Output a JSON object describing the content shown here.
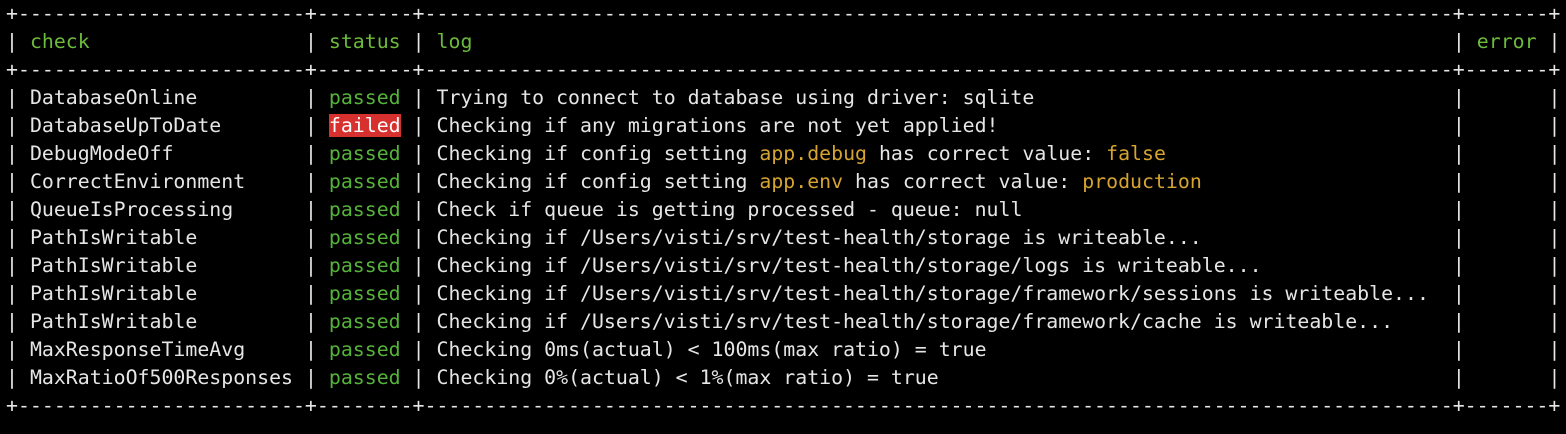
{
  "colors": {
    "background": "#000000",
    "text": "#e6e6e6",
    "header": "#6cbb3c",
    "passed": "#56b33a",
    "failed_bg": "#d7312f",
    "highlight": "#d6a431"
  },
  "columns": {
    "check": "check",
    "status": "status",
    "log": "log",
    "error": "error"
  },
  "rows": [
    {
      "check": "DatabaseOnline",
      "status": "passed",
      "log": [
        {
          "t": "Trying to connect to database using driver: sqlite",
          "c": "txt"
        }
      ],
      "error": ""
    },
    {
      "check": "DatabaseUpToDate",
      "status": "failed",
      "log": [
        {
          "t": "Checking if any migrations are not yet applied!",
          "c": "txt"
        }
      ],
      "error": ""
    },
    {
      "check": "DebugModeOff",
      "status": "passed",
      "log": [
        {
          "t": "Checking if config setting ",
          "c": "txt"
        },
        {
          "t": "app.debug",
          "c": "hl"
        },
        {
          "t": " has correct value: ",
          "c": "txt"
        },
        {
          "t": "false",
          "c": "hl"
        }
      ],
      "error": ""
    },
    {
      "check": "CorrectEnvironment",
      "status": "passed",
      "log": [
        {
          "t": "Checking if config setting ",
          "c": "txt"
        },
        {
          "t": "app.env",
          "c": "hl"
        },
        {
          "t": " has correct value: ",
          "c": "txt"
        },
        {
          "t": "production",
          "c": "hl"
        }
      ],
      "error": ""
    },
    {
      "check": "QueueIsProcessing",
      "status": "passed",
      "log": [
        {
          "t": "Check if queue is getting processed - queue: null",
          "c": "txt"
        }
      ],
      "error": ""
    },
    {
      "check": "PathIsWritable",
      "status": "passed",
      "log": [
        {
          "t": "Checking if /Users/visti/srv/test-health/storage is writeable...",
          "c": "txt"
        }
      ],
      "error": ""
    },
    {
      "check": "PathIsWritable",
      "status": "passed",
      "log": [
        {
          "t": "Checking if /Users/visti/srv/test-health/storage/logs is writeable...",
          "c": "txt"
        }
      ],
      "error": ""
    },
    {
      "check": "PathIsWritable",
      "status": "passed",
      "log": [
        {
          "t": "Checking if /Users/visti/srv/test-health/storage/framework/sessions is writeable...",
          "c": "txt"
        }
      ],
      "error": ""
    },
    {
      "check": "PathIsWritable",
      "status": "passed",
      "log": [
        {
          "t": "Checking if /Users/visti/srv/test-health/storage/framework/cache is writeable...",
          "c": "txt"
        }
      ],
      "error": ""
    },
    {
      "check": "MaxResponseTimeAvg",
      "status": "passed",
      "log": [
        {
          "t": "Checking 0ms(actual) < 100ms(max ratio) = true",
          "c": "txt"
        }
      ],
      "error": ""
    },
    {
      "check": "MaxRatioOf500Responses",
      "status": "passed",
      "log": [
        {
          "t": "Checking 0%(actual) < 1%(max ratio) = true",
          "c": "txt"
        }
      ],
      "error": ""
    }
  ]
}
